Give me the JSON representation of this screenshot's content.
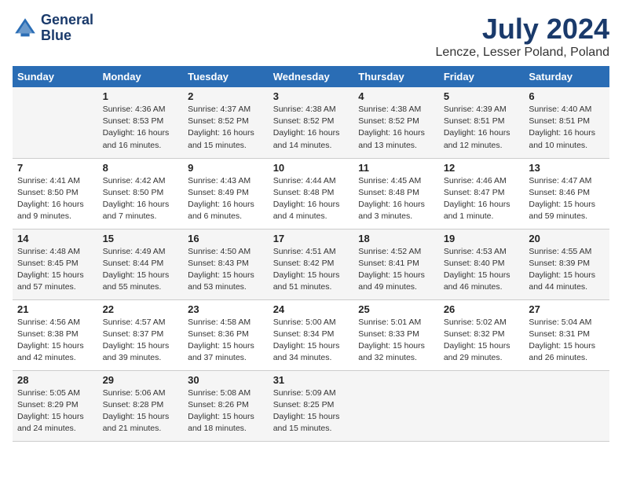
{
  "header": {
    "logo_line1": "General",
    "logo_line2": "Blue",
    "month_year": "July 2024",
    "location": "Lencze, Lesser Poland, Poland"
  },
  "days_of_week": [
    "Sunday",
    "Monday",
    "Tuesday",
    "Wednesday",
    "Thursday",
    "Friday",
    "Saturday"
  ],
  "weeks": [
    [
      {
        "day": "",
        "info": ""
      },
      {
        "day": "1",
        "info": "Sunrise: 4:36 AM\nSunset: 8:53 PM\nDaylight: 16 hours\nand 16 minutes."
      },
      {
        "day": "2",
        "info": "Sunrise: 4:37 AM\nSunset: 8:52 PM\nDaylight: 16 hours\nand 15 minutes."
      },
      {
        "day": "3",
        "info": "Sunrise: 4:38 AM\nSunset: 8:52 PM\nDaylight: 16 hours\nand 14 minutes."
      },
      {
        "day": "4",
        "info": "Sunrise: 4:38 AM\nSunset: 8:52 PM\nDaylight: 16 hours\nand 13 minutes."
      },
      {
        "day": "5",
        "info": "Sunrise: 4:39 AM\nSunset: 8:51 PM\nDaylight: 16 hours\nand 12 minutes."
      },
      {
        "day": "6",
        "info": "Sunrise: 4:40 AM\nSunset: 8:51 PM\nDaylight: 16 hours\nand 10 minutes."
      }
    ],
    [
      {
        "day": "7",
        "info": "Sunrise: 4:41 AM\nSunset: 8:50 PM\nDaylight: 16 hours\nand 9 minutes."
      },
      {
        "day": "8",
        "info": "Sunrise: 4:42 AM\nSunset: 8:50 PM\nDaylight: 16 hours\nand 7 minutes."
      },
      {
        "day": "9",
        "info": "Sunrise: 4:43 AM\nSunset: 8:49 PM\nDaylight: 16 hours\nand 6 minutes."
      },
      {
        "day": "10",
        "info": "Sunrise: 4:44 AM\nSunset: 8:48 PM\nDaylight: 16 hours\nand 4 minutes."
      },
      {
        "day": "11",
        "info": "Sunrise: 4:45 AM\nSunset: 8:48 PM\nDaylight: 16 hours\nand 3 minutes."
      },
      {
        "day": "12",
        "info": "Sunrise: 4:46 AM\nSunset: 8:47 PM\nDaylight: 16 hours\nand 1 minute."
      },
      {
        "day": "13",
        "info": "Sunrise: 4:47 AM\nSunset: 8:46 PM\nDaylight: 15 hours\nand 59 minutes."
      }
    ],
    [
      {
        "day": "14",
        "info": "Sunrise: 4:48 AM\nSunset: 8:45 PM\nDaylight: 15 hours\nand 57 minutes."
      },
      {
        "day": "15",
        "info": "Sunrise: 4:49 AM\nSunset: 8:44 PM\nDaylight: 15 hours\nand 55 minutes."
      },
      {
        "day": "16",
        "info": "Sunrise: 4:50 AM\nSunset: 8:43 PM\nDaylight: 15 hours\nand 53 minutes."
      },
      {
        "day": "17",
        "info": "Sunrise: 4:51 AM\nSunset: 8:42 PM\nDaylight: 15 hours\nand 51 minutes."
      },
      {
        "day": "18",
        "info": "Sunrise: 4:52 AM\nSunset: 8:41 PM\nDaylight: 15 hours\nand 49 minutes."
      },
      {
        "day": "19",
        "info": "Sunrise: 4:53 AM\nSunset: 8:40 PM\nDaylight: 15 hours\nand 46 minutes."
      },
      {
        "day": "20",
        "info": "Sunrise: 4:55 AM\nSunset: 8:39 PM\nDaylight: 15 hours\nand 44 minutes."
      }
    ],
    [
      {
        "day": "21",
        "info": "Sunrise: 4:56 AM\nSunset: 8:38 PM\nDaylight: 15 hours\nand 42 minutes."
      },
      {
        "day": "22",
        "info": "Sunrise: 4:57 AM\nSunset: 8:37 PM\nDaylight: 15 hours\nand 39 minutes."
      },
      {
        "day": "23",
        "info": "Sunrise: 4:58 AM\nSunset: 8:36 PM\nDaylight: 15 hours\nand 37 minutes."
      },
      {
        "day": "24",
        "info": "Sunrise: 5:00 AM\nSunset: 8:34 PM\nDaylight: 15 hours\nand 34 minutes."
      },
      {
        "day": "25",
        "info": "Sunrise: 5:01 AM\nSunset: 8:33 PM\nDaylight: 15 hours\nand 32 minutes."
      },
      {
        "day": "26",
        "info": "Sunrise: 5:02 AM\nSunset: 8:32 PM\nDaylight: 15 hours\nand 29 minutes."
      },
      {
        "day": "27",
        "info": "Sunrise: 5:04 AM\nSunset: 8:31 PM\nDaylight: 15 hours\nand 26 minutes."
      }
    ],
    [
      {
        "day": "28",
        "info": "Sunrise: 5:05 AM\nSunset: 8:29 PM\nDaylight: 15 hours\nand 24 minutes."
      },
      {
        "day": "29",
        "info": "Sunrise: 5:06 AM\nSunset: 8:28 PM\nDaylight: 15 hours\nand 21 minutes."
      },
      {
        "day": "30",
        "info": "Sunrise: 5:08 AM\nSunset: 8:26 PM\nDaylight: 15 hours\nand 18 minutes."
      },
      {
        "day": "31",
        "info": "Sunrise: 5:09 AM\nSunset: 8:25 PM\nDaylight: 15 hours\nand 15 minutes."
      },
      {
        "day": "",
        "info": ""
      },
      {
        "day": "",
        "info": ""
      },
      {
        "day": "",
        "info": ""
      }
    ]
  ]
}
